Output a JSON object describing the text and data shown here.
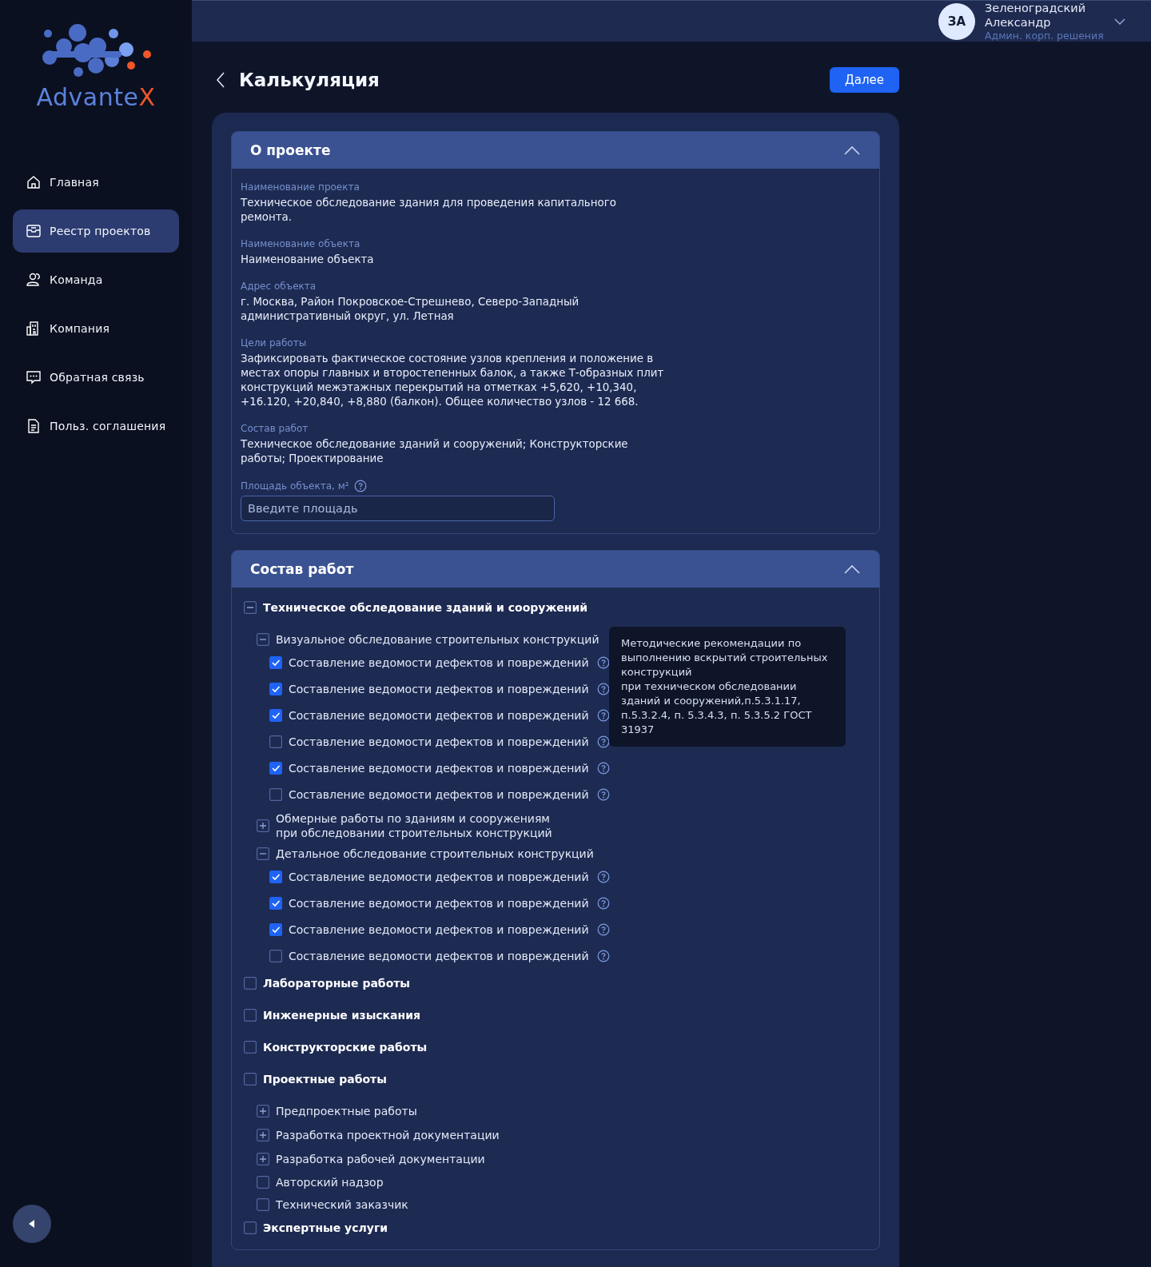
{
  "logo": {
    "text": "Advante",
    "accent": "X"
  },
  "nav": [
    {
      "label": "Главная",
      "selected": false
    },
    {
      "label": "Реестр проектов",
      "selected": true
    },
    {
      "label": "Команда",
      "selected": false
    },
    {
      "label": "Компания",
      "selected": false
    },
    {
      "label": "Обратная связь",
      "selected": false
    },
    {
      "label": "Польз. соглашения",
      "selected": false
    }
  ],
  "user": {
    "initials": "ЗА",
    "name": "Зеленоградский Александр",
    "role": "Админ. корп. решения"
  },
  "page": {
    "title": "Калькуляция",
    "next_button": "Далее"
  },
  "about": {
    "title": "О проекте",
    "expanded": true,
    "fields": [
      {
        "label": "Наименование проекта",
        "value": "Техническое обследование здания для проведения капитального ремонта."
      },
      {
        "label": "Наименование объекта",
        "value": "Наименование объекта"
      },
      {
        "label": "Адрес объекта",
        "value": "г. Москва, Район Покровское-Стрешнево, Северо-Западный административный округ, ул. Летная"
      },
      {
        "label": "Цели работы",
        "value": "Зафиксировать фактическое состояние узлов крепления и положение в местах опоры главных и второстепенных балок, а также Т-образных плит конструкций межэтажных перекрытий на отметках +5,620, +10,340, +16.120, +20,840, +8,880 (балкон). Общее количество узлов - 12 668."
      },
      {
        "label": "Состав работ",
        "value": "Техническое обследование зданий и сооружений; Конструкторские работы; Проектирование"
      }
    ],
    "area": {
      "label": "Площадь объекта, м²",
      "placeholder": "Введите площадь"
    }
  },
  "works": {
    "title": "Состав работ",
    "expanded": true,
    "tooltip": "Методические рекомендации по выполнению вскрытий строительных конструкций\nпри техническом обследовании зданий и сооружений,п.5.3.1.17, п.5.3.2.4, п. 5.3.4.3, п. 5.3.5.2 ГОСТ 31937",
    "items": [
      {
        "kind": "toggle",
        "label": "Техническое обследование зданий и сооружений",
        "expanded": true,
        "children": [
          {
            "kind": "toggle",
            "label": "Визуальное обследование строительных конструкций",
            "expanded": true,
            "children": [
              {
                "kind": "checkbox",
                "label": "Составление ведомости дефектов и повреждений",
                "checked": true,
                "help": true
              },
              {
                "kind": "checkbox",
                "label": "Составление ведомости дефектов и повреждений",
                "checked": true,
                "help": true
              },
              {
                "kind": "checkbox",
                "label": "Составление ведомости дефектов и повреждений",
                "checked": true,
                "help": true
              },
              {
                "kind": "checkbox",
                "label": "Составление ведомости дефектов и повреждений",
                "checked": false,
                "help": true
              },
              {
                "kind": "checkbox",
                "label": "Составление ведомости дефектов и повреждений",
                "checked": true,
                "help": true
              },
              {
                "kind": "checkbox",
                "label": "Составление ведомости дефектов и повреждений",
                "checked": false,
                "help": true
              }
            ]
          },
          {
            "kind": "toggle",
            "label": "Обмерные работы по зданиям и сооружениям\nпри обследовании строительных конструкций",
            "expanded": false
          },
          {
            "kind": "toggle",
            "label": "Детальное обследование строительных конструкций",
            "expanded": true,
            "children": [
              {
                "kind": "checkbox",
                "label": "Составление ведомости дефектов и повреждений",
                "checked": true,
                "help": true
              },
              {
                "kind": "checkbox",
                "label": "Составление ведомости дефектов и повреждений",
                "checked": true,
                "help": true
              },
              {
                "kind": "checkbox",
                "label": "Составление ведомости дефектов и повреждений",
                "checked": true,
                "help": true
              },
              {
                "kind": "checkbox",
                "label": "Составление ведомости дефектов и повреждений",
                "checked": false,
                "help": true
              }
            ]
          }
        ]
      },
      {
        "kind": "checkbox",
        "label": "Лабораторные работы",
        "checked": false
      },
      {
        "kind": "checkbox",
        "label": "Инженерные изыскания",
        "checked": false
      },
      {
        "kind": "checkbox",
        "label": "Конструкторские работы",
        "checked": false
      },
      {
        "kind": "checkbox",
        "label": "Проектные работы",
        "checked": false,
        "children": [
          {
            "kind": "toggle",
            "label": "Предпроектные работы",
            "expanded": false
          },
          {
            "kind": "toggle",
            "label": "Разработка проектной документации",
            "expanded": false
          },
          {
            "kind": "toggle",
            "label": "Разработка рабочей документации",
            "expanded": false
          },
          {
            "kind": "checkbox",
            "label": "Авторский надзор",
            "checked": false
          },
          {
            "kind": "checkbox",
            "label": "Технический заказчик",
            "checked": false
          }
        ]
      },
      {
        "kind": "checkbox",
        "label": "Экспертные услуги",
        "checked": false
      }
    ]
  }
}
